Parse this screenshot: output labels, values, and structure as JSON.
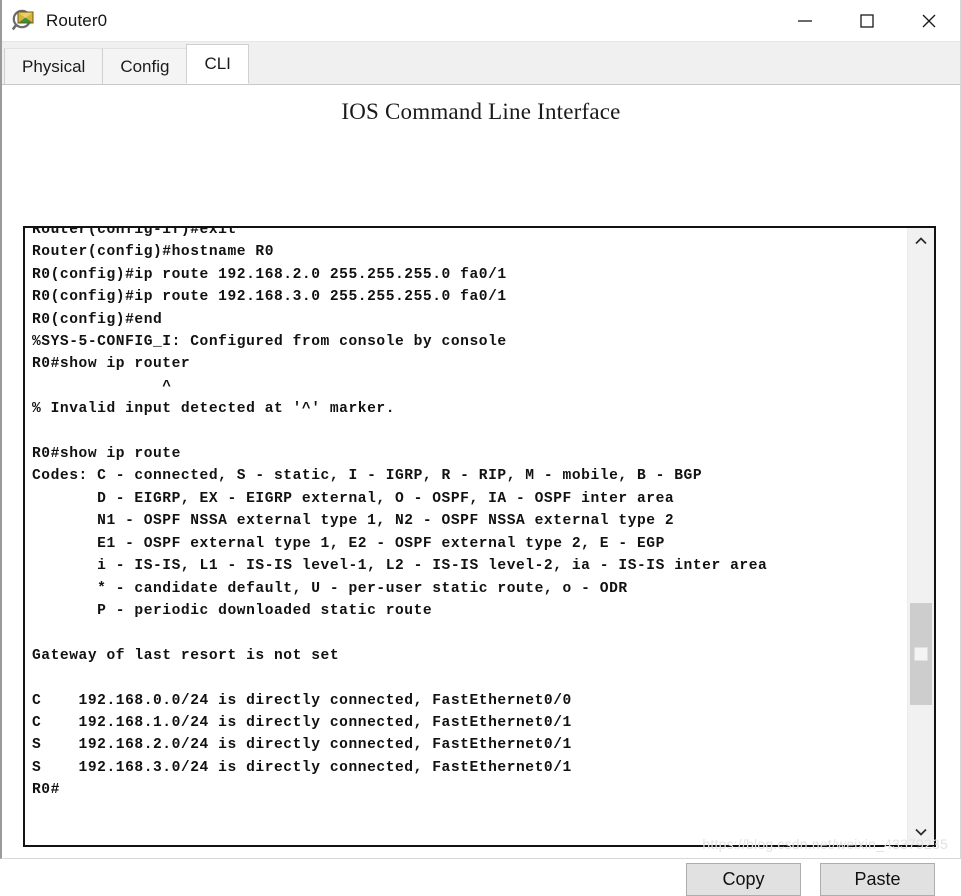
{
  "window": {
    "title": "Router0",
    "icon": "router-magnifier-icon",
    "controls": [
      {
        "name": "minimize",
        "glyph": "minimize-icon"
      },
      {
        "name": "maximize",
        "glyph": "maximize-icon"
      },
      {
        "name": "close",
        "glyph": "close-icon"
      }
    ]
  },
  "tabs": [
    {
      "label": "Physical",
      "active": false
    },
    {
      "label": "Config",
      "active": false
    },
    {
      "label": "CLI",
      "active": true
    }
  ],
  "cli": {
    "heading": "IOS Command Line Interface",
    "lines": [
      "Router(config-if)#exit",
      "Router(config)#hostname R0",
      "R0(config)#ip route 192.168.2.0 255.255.255.0 fa0/1",
      "R0(config)#ip route 192.168.3.0 255.255.255.0 fa0/1",
      "R0(config)#end",
      "%SYS-5-CONFIG_I: Configured from console by console",
      "R0#show ip router",
      "              ^",
      "% Invalid input detected at '^' marker.",
      "",
      "R0#show ip route",
      "Codes: C - connected, S - static, I - IGRP, R - RIP, M - mobile, B - BGP",
      "       D - EIGRP, EX - EIGRP external, O - OSPF, IA - OSPF inter area",
      "       N1 - OSPF NSSA external type 1, N2 - OSPF NSSA external type 2",
      "       E1 - OSPF external type 1, E2 - OSPF external type 2, E - EGP",
      "       i - IS-IS, L1 - IS-IS level-1, L2 - IS-IS level-2, ia - IS-IS inter area",
      "       * - candidate default, U - per-user static route, o - ODR",
      "       P - periodic downloaded static route",
      "",
      "Gateway of last resort is not set",
      "",
      "C    192.168.0.0/24 is directly connected, FastEthernet0/0",
      "C    192.168.1.0/24 is directly connected, FastEthernet0/1",
      "S    192.168.2.0/24 is directly connected, FastEthernet0/1",
      "S    192.168.3.0/24 is directly connected, FastEthernet0/1",
      "R0#"
    ]
  },
  "scrollbar": {
    "up_arrow": "chevron-up-icon",
    "down_arrow": "chevron-down-icon"
  },
  "buttons": {
    "copy_label": "Copy",
    "paste_label": "Paste"
  },
  "watermark": "https://blog.csdn.net/weixin_43379235",
  "colors": {
    "tab_active_bg": "#ffffff",
    "tab_inactive_bg": "#f4f4f4",
    "tabstrip_bg": "#f0f0f0",
    "terminal_border": "#121212",
    "terminal_text": "#111111",
    "button_bg": "#e1e1e1",
    "scroll_thumb": "#cdcdcd",
    "watermark": "#e2e2e2"
  }
}
